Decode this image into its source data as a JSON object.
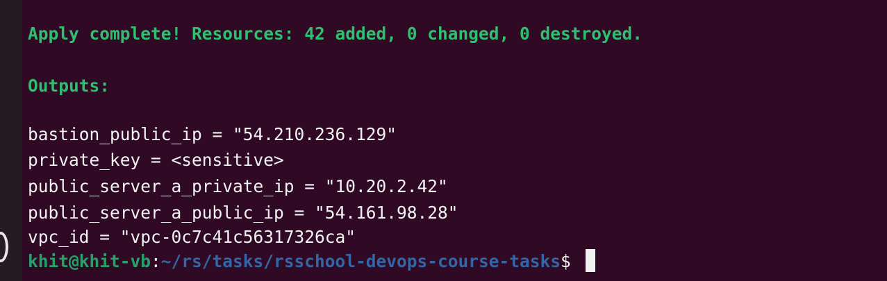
{
  "terminal": {
    "apply_message": "Apply complete! Resources: 42 added, 0 changed, 0 destroyed.",
    "outputs_header": "Outputs:",
    "outputs": [
      "bastion_public_ip = \"54.210.236.129\"",
      "private_key = <sensitive>",
      "public_server_a_private_ip = \"10.20.2.42\"",
      "public_server_a_public_ip = \"54.161.98.28\"",
      "vpc_id = \"vpc-0c7c41c56317326ca\""
    ],
    "prompt": {
      "user_host": "khit@khit-vb",
      "separator": ":",
      "path": "~/rs/tasks/rsschool-devops-course-tasks",
      "symbol": "$ "
    }
  },
  "colors": {
    "background": "#300a24",
    "success_text": "#2fbf71",
    "prompt_user": "#26a269",
    "prompt_path": "#3465a4",
    "text": "#f2f2f2"
  },
  "icons": {
    "dock": "app-icon"
  }
}
